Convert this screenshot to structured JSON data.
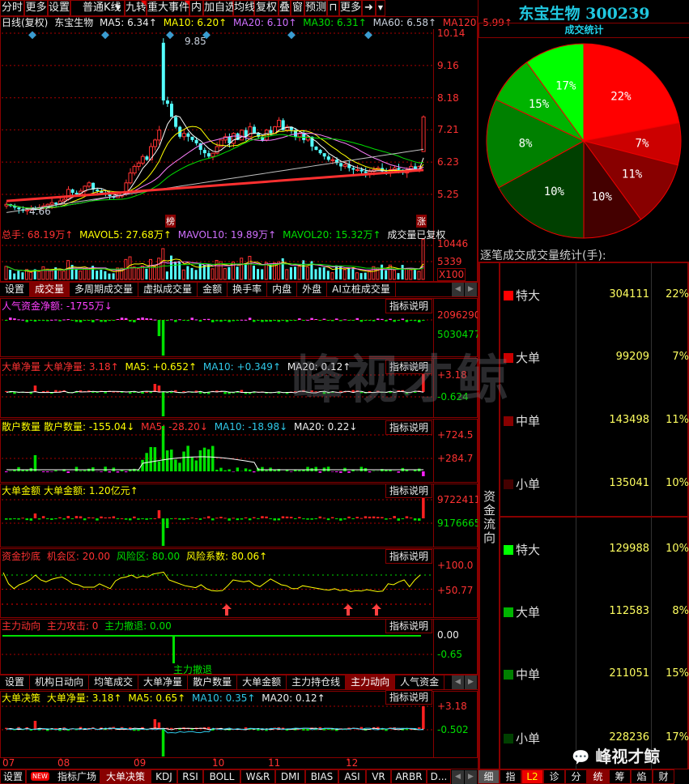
{
  "toolbar": {
    "items": [
      "分时",
      "更多",
      "设置",
      "普通K线",
      "九转",
      "重大事件",
      "内",
      "加自选",
      "均线",
      "复权",
      "叠",
      "窗",
      "预测",
      "更多"
    ]
  },
  "price_legend": {
    "period": "日线(复权)",
    "stock": "东宝生物",
    "ma5": "MA5: 6.34↑",
    "ma10": "MA10: 6.20↑",
    "ma20": "MA20: 6.10↑",
    "ma30": "MA30: 6.31↑",
    "ma60": "MA60: 6.58↑",
    "ma120": "MA120: 5.99↑"
  },
  "price_axis": [
    "10.14",
    "9.16",
    "8.18",
    "7.21",
    "6.23",
    "5.25"
  ],
  "price_marks": {
    "high": "9.85",
    "low": "4.66",
    "tag1": "榜",
    "tag2": "涨"
  },
  "volume": {
    "total": "总手: 68.19万↑",
    "mavol5": "MAVOL5: 27.68万↑",
    "mavol10": "MAVOL10: 19.89万↑",
    "mavol20": "MAVOL20: 15.32万↑",
    "note": "成交量已复权",
    "axis": [
      "10446",
      "5339",
      "X100"
    ]
  },
  "tabs1": [
    "设置",
    "成交量",
    "多周期成交量",
    "虚拟成交量",
    "金额",
    "换手率",
    "内盘",
    "外盘",
    "AI立桩成交量"
  ],
  "help_label": "指标说明",
  "panels": {
    "rqzj": {
      "title": "人气资金净额: -1755万↓",
      "axis": [
        "2096290",
        "5030477"
      ]
    },
    "ddjl": {
      "name": "大单净量",
      "v": "大单净量: 3.18↑",
      "ma5": "MA5: +0.652↑",
      "ma10": "MA10: +0.349↑",
      "ma20": "MA20: 0.12↑",
      "axis": [
        "+3.18",
        "-0.624"
      ]
    },
    "sh": {
      "name": "散户数量",
      "v": "散户数量: -155.04↓",
      "ma5": "MA5: -28.20↓",
      "ma10": "MA10: -18.98↓",
      "ma20": "MA20: 0.22↓",
      "axis": [
        "+724.5",
        "+284.7"
      ]
    },
    "ddje": {
      "name": "大单金额",
      "v": "大单金额: 1.20亿元↑",
      "axis": [
        "9722411",
        "9176665"
      ]
    },
    "zjcd": {
      "name": "资金抄底",
      "a": "机会区: 20.00",
      "b": "风险区: 80.00",
      "c": "风险系数: 80.06↑",
      "axis": [
        "+100.0",
        "+50.77"
      ],
      "risk_series": [
        85,
        62,
        52,
        60,
        64,
        70,
        80,
        70,
        66,
        71,
        74,
        76,
        70,
        62,
        60,
        55,
        55,
        55,
        62,
        57,
        52,
        68,
        74,
        76,
        80,
        74,
        78,
        76,
        82,
        84,
        86,
        70,
        66,
        62,
        58,
        56,
        54,
        60,
        52,
        48,
        47,
        48,
        58,
        70,
        68,
        66,
        68,
        60,
        56,
        64,
        72,
        66,
        60,
        58,
        52,
        52,
        58,
        56,
        54,
        52,
        50,
        49,
        52,
        48,
        50,
        46,
        48,
        47,
        50,
        48,
        46,
        47,
        62,
        60,
        66,
        70,
        56,
        70,
        80
      ]
    },
    "zldx": {
      "name": "主力动向",
      "a": "主力攻击: 0",
      "b": "主力撤退: 0.00",
      "axis": [
        "0.00",
        "-0.65"
      ],
      "mark": "主力撤退"
    },
    "ddjc": {
      "name": "大单决策",
      "v": "大单净量: 3.18↑",
      "ma5": "MA5: 0.65↑",
      "ma10": "MA10: 0.35↑",
      "ma20": "MA20: 0.12↑",
      "axis": [
        "+3.18",
        "-0.502"
      ]
    }
  },
  "tabs2": [
    "设置",
    "机构日动向",
    "均笔成交",
    "大单净量",
    "散户数量",
    "大单金额",
    "主力持仓线",
    "主力动向",
    "人气资金"
  ],
  "months": [
    "07",
    "08",
    "09",
    "10",
    "11",
    "12"
  ],
  "bottom_tabs": {
    "new_badge": "NEW",
    "items": [
      "设置",
      "指标广场",
      "大单决策",
      "KDJ",
      "RSI",
      "BOLL",
      "W&R",
      "DMI",
      "BIAS",
      "ASI",
      "VR",
      "ARBR",
      "D..."
    ]
  },
  "right": {
    "title": "东宝生物 300239",
    "pie_title": "成交统计",
    "table_title": "逐笔成交成交量统计(手):",
    "side_label": "资金流向",
    "rows": [
      {
        "label": "特大",
        "value": "304111",
        "pct": "22%",
        "color": "#ff0000"
      },
      {
        "label": "大单",
        "value": "99209",
        "pct": "7%",
        "color": "#cc0000"
      },
      {
        "label": "中单",
        "value": "143498",
        "pct": "11%",
        "color": "#880000"
      },
      {
        "label": "小单",
        "value": "135041",
        "pct": "10%",
        "color": "#440000"
      },
      {
        "label": "特大",
        "value": "129988",
        "pct": "10%",
        "color": "#00ff00"
      },
      {
        "label": "大单",
        "value": "112583",
        "pct": "8%",
        "color": "#00b400"
      },
      {
        "label": "中单",
        "value": "211051",
        "pct": "15%",
        "color": "#008000"
      },
      {
        "label": "小单",
        "value": "228236",
        "pct": "17%",
        "color": "#004000"
      }
    ],
    "bottom_tabs": [
      "细",
      "指",
      "L2",
      "诊",
      "分",
      "统",
      "筹",
      "焰",
      "财"
    ],
    "watermark": "峰视才鲸"
  },
  "chart_data": {
    "type": "candlestick",
    "closes": [
      4.95,
      4.9,
      4.85,
      4.8,
      4.75,
      4.78,
      4.82,
      4.8,
      4.85,
      4.9,
      4.95,
      5.0,
      4.95,
      5.05,
      5.1,
      5.4,
      5.3,
      5.25,
      5.35,
      5.5,
      5.6,
      5.4,
      5.35,
      5.3,
      5.25,
      5.2,
      5.15,
      5.2,
      5.3,
      5.6,
      5.9,
      6.1,
      6.2,
      6.4,
      6.3,
      6.7,
      6.9,
      7.2,
      8.1,
      8.0,
      7.6,
      7.3,
      7.0,
      7.1,
      7.0,
      6.9,
      6.8,
      6.6,
      6.5,
      6.4,
      6.5,
      6.7,
      6.9,
      7.0,
      6.8,
      7.1,
      6.9,
      7.2,
      7.0,
      7.3,
      7.1,
      7.0,
      6.9,
      7.2,
      7.1,
      7.3,
      7.5,
      7.2,
      7.3,
      7.2,
      7.0,
      7.1,
      6.9,
      7.0,
      6.7,
      6.6,
      6.5,
      6.4,
      6.3,
      6.3,
      6.2,
      6.1,
      6.15,
      6.05,
      6.0,
      6.0,
      5.95,
      5.9,
      5.95,
      6.0,
      6.05,
      5.95,
      5.9,
      6.0,
      6.05,
      6.0,
      5.9,
      6.0,
      6.1,
      6.0,
      6.1,
      7.6
    ],
    "spike": {
      "index": 38,
      "open": 9.85
    },
    "ylim": [
      5.25,
      10.14
    ],
    "pie": [
      22,
      7,
      11,
      10,
      17,
      15,
      8,
      10
    ]
  }
}
